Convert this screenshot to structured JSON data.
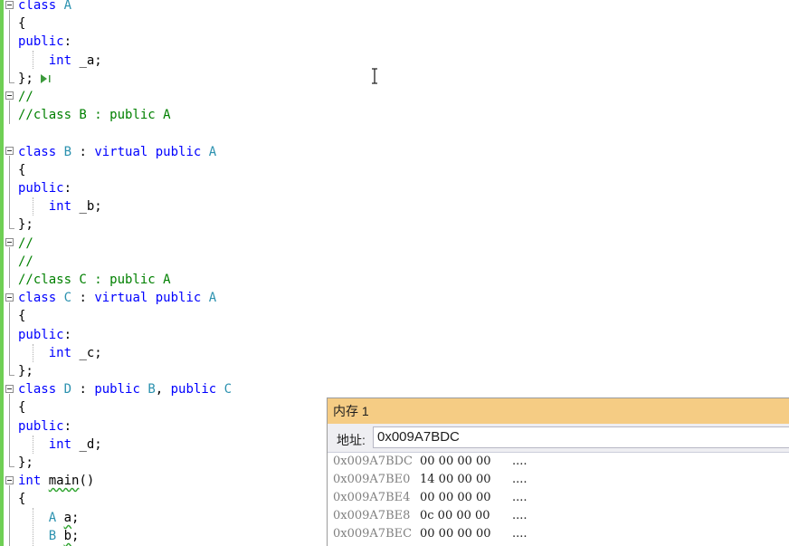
{
  "editor": {
    "lines": [
      [
        {
          "t": "class ",
          "c": "kw"
        },
        {
          "t": "A",
          "c": "ty"
        }
      ],
      [
        {
          "t": "{",
          "c": "id"
        }
      ],
      [
        {
          "t": "public",
          "c": "kw"
        },
        {
          "t": ":",
          "c": "id"
        }
      ],
      [
        {
          "t": "    ",
          "c": "id"
        },
        {
          "t": "int",
          "c": "kw"
        },
        {
          "t": " _a;",
          "c": "id"
        }
      ],
      [
        {
          "t": "};",
          "c": "id"
        }
      ],
      [
        {
          "t": "//",
          "c": "cm"
        }
      ],
      [
        {
          "t": "//class B : public A",
          "c": "cm"
        }
      ],
      [],
      [
        {
          "t": "class ",
          "c": "kw"
        },
        {
          "t": "B",
          "c": "ty"
        },
        {
          "t": " : ",
          "c": "id"
        },
        {
          "t": "virtual public ",
          "c": "kw"
        },
        {
          "t": "A",
          "c": "ty"
        }
      ],
      [
        {
          "t": "{",
          "c": "id"
        }
      ],
      [
        {
          "t": "public",
          "c": "kw"
        },
        {
          "t": ":",
          "c": "id"
        }
      ],
      [
        {
          "t": "    ",
          "c": "id"
        },
        {
          "t": "int",
          "c": "kw"
        },
        {
          "t": " _b;",
          "c": "id"
        }
      ],
      [
        {
          "t": "};",
          "c": "id"
        }
      ],
      [
        {
          "t": "//",
          "c": "cm"
        }
      ],
      [
        {
          "t": "//",
          "c": "cm"
        }
      ],
      [
        {
          "t": "//class C : public A",
          "c": "cm"
        }
      ],
      [
        {
          "t": "class ",
          "c": "kw"
        },
        {
          "t": "C",
          "c": "ty"
        },
        {
          "t": " : ",
          "c": "id"
        },
        {
          "t": "virtual public ",
          "c": "kw"
        },
        {
          "t": "A",
          "c": "ty"
        }
      ],
      [
        {
          "t": "{",
          "c": "id"
        }
      ],
      [
        {
          "t": "public",
          "c": "kw"
        },
        {
          "t": ":",
          "c": "id"
        }
      ],
      [
        {
          "t": "    ",
          "c": "id"
        },
        {
          "t": "int",
          "c": "kw"
        },
        {
          "t": " _c;",
          "c": "id"
        }
      ],
      [
        {
          "t": "};",
          "c": "id"
        }
      ],
      [
        {
          "t": "class ",
          "c": "kw"
        },
        {
          "t": "D",
          "c": "ty"
        },
        {
          "t": " : ",
          "c": "id"
        },
        {
          "t": "public ",
          "c": "kw"
        },
        {
          "t": "B",
          "c": "ty"
        },
        {
          "t": ", ",
          "c": "id"
        },
        {
          "t": "public ",
          "c": "kw"
        },
        {
          "t": "C",
          "c": "ty"
        }
      ],
      [
        {
          "t": "{",
          "c": "id"
        }
      ],
      [
        {
          "t": "public",
          "c": "kw"
        },
        {
          "t": ":",
          "c": "id"
        }
      ],
      [
        {
          "t": "    ",
          "c": "id"
        },
        {
          "t": "int",
          "c": "kw"
        },
        {
          "t": " _d;",
          "c": "id"
        }
      ],
      [
        {
          "t": "};",
          "c": "id"
        }
      ],
      [
        {
          "t": "int ",
          "c": "kw"
        },
        {
          "t": "main",
          "c": "id",
          "sq": true
        },
        {
          "t": "()",
          "c": "id"
        }
      ],
      [
        {
          "t": "{",
          "c": "id"
        }
      ],
      [
        {
          "t": "    ",
          "c": "id"
        },
        {
          "t": "A",
          "c": "ty"
        },
        {
          "t": " ",
          "c": "id"
        },
        {
          "t": "a",
          "c": "id",
          "sq": true
        },
        {
          "t": ";",
          "c": "id"
        }
      ],
      [
        {
          "t": "    ",
          "c": "id"
        },
        {
          "t": "B",
          "c": "ty"
        },
        {
          "t": " ",
          "c": "id"
        },
        {
          "t": "b",
          "c": "id",
          "sq": true
        },
        {
          "t": ";",
          "c": "id"
        }
      ]
    ]
  },
  "colors": {
    "keyword": "#0000ff",
    "type": "#2b91af",
    "comment": "#008000",
    "change_bar": "#6fcf54",
    "memory_title_bg": "#f5cc84"
  },
  "icons": {
    "fold": "collapse-minus-icon",
    "run": "run-to-click-icon",
    "cursor": "text-cursor-icon"
  },
  "memory": {
    "title": "内存 1",
    "address_label": "地址:",
    "address_value": "0x009A7BDC",
    "rows": [
      {
        "address": "0x009A7BDC",
        "bytes": "00 00 00 00",
        "ascii": "...."
      },
      {
        "address": "0x009A7BE0",
        "bytes": "14 00 00 00",
        "ascii": "...."
      },
      {
        "address": "0x009A7BE4",
        "bytes": "00 00 00 00",
        "ascii": "...."
      },
      {
        "address": "0x009A7BE8",
        "bytes": "0c 00 00 00",
        "ascii": "...."
      },
      {
        "address": "0x009A7BEC",
        "bytes": "00 00 00 00",
        "ascii": "...."
      }
    ]
  }
}
